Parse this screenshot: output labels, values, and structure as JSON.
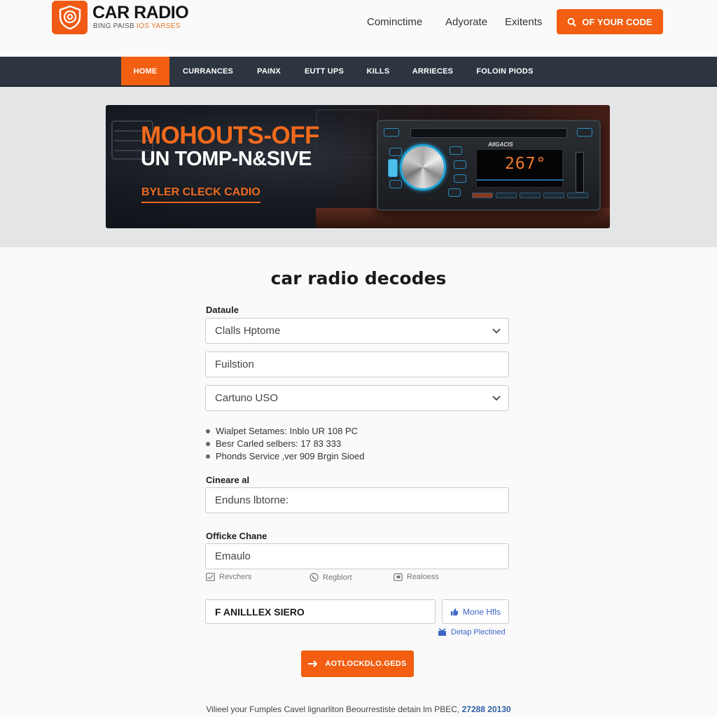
{
  "header": {
    "logo_title": "CAR RADIO",
    "logo_sub_a": "BING PAISB",
    "logo_sub_b": "IOS YARSES",
    "links": [
      "Cominctime",
      "Adyorate",
      "Exitents"
    ],
    "cta_label": "OF YOUR CODE",
    "cta_icon": "search-icon",
    "brand_color": "#f25f12"
  },
  "nav": {
    "items": [
      {
        "label": "HOME",
        "active": true
      },
      {
        "label": "CURRANCES",
        "active": false
      },
      {
        "label": "PAINX",
        "active": false
      },
      {
        "label": "EUTT UPS",
        "active": false
      },
      {
        "label": "KILLS",
        "active": false
      },
      {
        "label": "ARRIECES",
        "active": false
      },
      {
        "label": "FOLOIN PIODS",
        "active": false
      }
    ]
  },
  "hero": {
    "headline": "MOHOUTS-OFF",
    "subheadline": "UN TOMP-N&SIVE",
    "link_label": "BYLER CLECK CADIO",
    "radio_brand": "AIIGACIS",
    "radio_display": "267°"
  },
  "form": {
    "title": "car radio decodes",
    "section1_label": "Dataule",
    "select1_value": "Clalls Hptome",
    "input1_value": "Fuilstion",
    "select2_value": "Cartuno USO",
    "bullets": [
      "Wialpet Setames: Inblo UR 108 PC",
      "Besr Carled selbers: 17 83 333",
      "Phonds Service ,ver 909 Brgin Sioed"
    ],
    "section2_label": "Cineare al",
    "input2_value": "Enduns lbtorne:",
    "section3_label": "Officke Chane",
    "input3_value": "Emaulo",
    "options": [
      {
        "icon": "checkbox-icon",
        "label": "Revchers"
      },
      {
        "icon": "phone-icon",
        "label": "Regblort"
      },
      {
        "icon": "calendar-icon",
        "label": "Realoess"
      }
    ],
    "promo_value": "F ANILLLEX SIERO",
    "more_label": "Mone Hfls",
    "more_icon": "thumbs-up-icon",
    "deep_link_label": "Detap Plectined",
    "deep_link_icon": "gift-icon",
    "submit_label": "AOTLOCKDLO.GEDS",
    "submit_icon": "arrow-right-icon"
  },
  "footer": {
    "text": "Vilieel your Fumples Cavel lignarliton Beourrestiste detain lm PBEC,",
    "number": "27288 20130"
  }
}
